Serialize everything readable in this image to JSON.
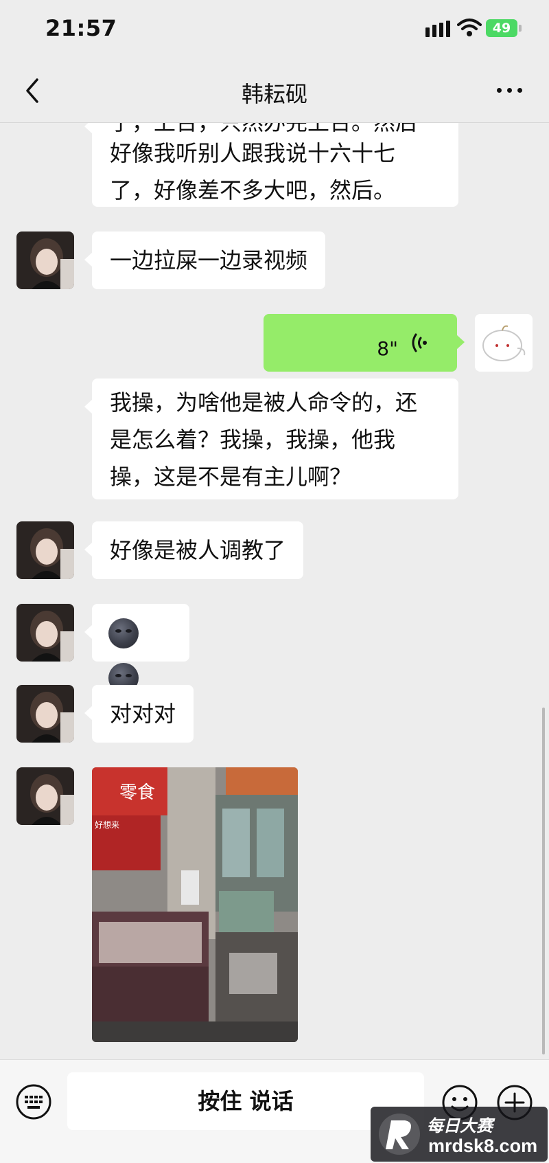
{
  "status_bar": {
    "time": "21:57",
    "battery": "49"
  },
  "nav": {
    "title": "韩耘砚"
  },
  "messages": {
    "m1_line1": "了，上台，只然办完上台。然后",
    "m1_line2": "好像我听别人跟我说十六十七",
    "m1_line3": "了，好像差不多大吧，然后。",
    "m2": "一边拉屎一边录视频",
    "voice_duration": "8\"",
    "m4_line1": "我操，为啥他是被人命令的，还",
    "m4_line2": "是怎么着？我操，我操，他我",
    "m4_line3": "操，这是不是有主儿啊？",
    "m5": "好像是被人调教了",
    "m7": "对对对",
    "photo_sign1": "零食",
    "photo_sign2": "好想来",
    "emoji_icons": [
      "new-moon-face-icon",
      "new-moon-face-icon"
    ]
  },
  "input_bar": {
    "talk_label": "按住 说话"
  },
  "watermark": {
    "cn": "每日大赛",
    "url": "mrdsk8.com"
  },
  "colors": {
    "background": "#ededed",
    "self_bubble": "#95ec69",
    "other_bubble": "#ffffff",
    "battery": "#4cd964"
  }
}
